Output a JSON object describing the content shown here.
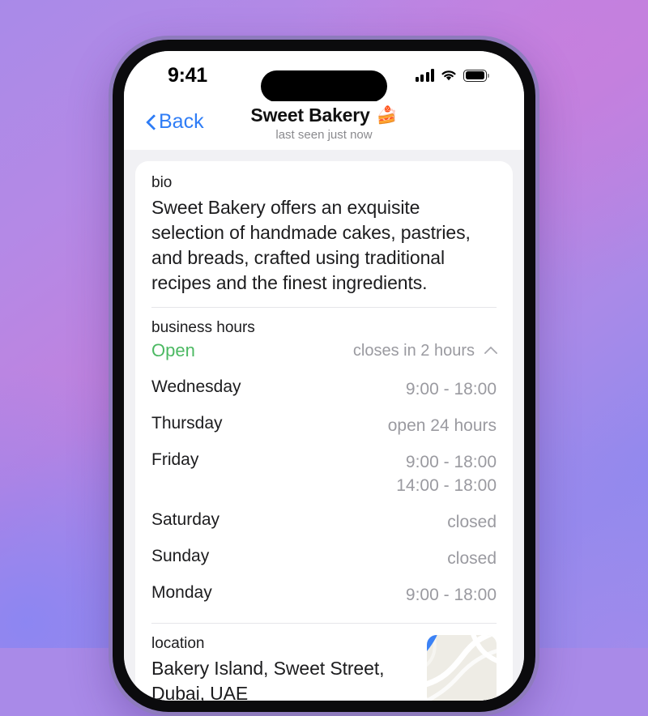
{
  "statusbar": {
    "time": "9:41",
    "signal_icon": "cellular-signal-icon",
    "wifi_icon": "wifi-icon",
    "battery_icon": "battery-full-icon"
  },
  "navbar": {
    "back_label": "Back",
    "title": "Sweet Bakery",
    "title_emoji": "🍰",
    "subtitle": "last seen just now"
  },
  "bio": {
    "label": "bio",
    "text": "Sweet Bakery offers an exquisite selection of handmade cakes, pastries, and breads, crafted using traditional recipes and the finest ingredients."
  },
  "hours": {
    "label": "business hours",
    "status": "Open",
    "status_color": "#4cb963",
    "closes_in": "closes in 2 hours",
    "collapse_icon": "chevron-up-icon",
    "days": [
      {
        "name": "Wednesday",
        "times": [
          "9:00 - 18:00"
        ]
      },
      {
        "name": "Thursday",
        "times": [
          "open 24 hours"
        ]
      },
      {
        "name": "Friday",
        "times": [
          "9:00 - 18:00",
          "14:00 - 18:00"
        ]
      },
      {
        "name": "Saturday",
        "times": [
          "closed"
        ]
      },
      {
        "name": "Sunday",
        "times": [
          "closed"
        ]
      },
      {
        "name": "Monday",
        "times": [
          "9:00 - 18:00"
        ]
      }
    ]
  },
  "location": {
    "label": "location",
    "address": "Bakery Island, Sweet Street, Dubai, UAE",
    "map_icon": "map-pin-icon",
    "pin_color": "#3b82f6"
  },
  "colors": {
    "accent_blue": "#2f7df6",
    "open_green": "#4cb963",
    "muted_gray": "#9a9aa0"
  }
}
